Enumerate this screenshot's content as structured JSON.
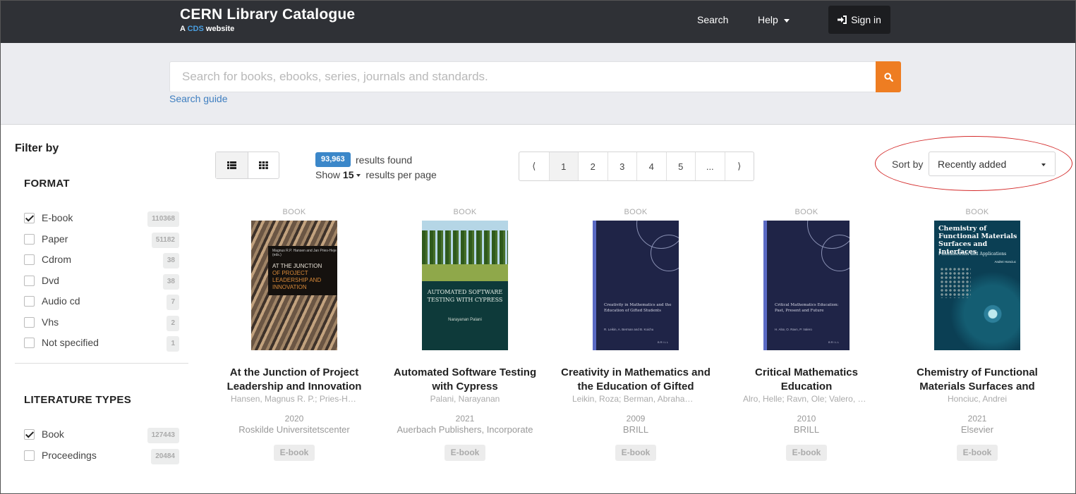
{
  "header": {
    "title": "CERN Library Catalogue",
    "subtitle_prefix": "A",
    "subtitle_link": "CDS",
    "subtitle_suffix": "website",
    "nav_search": "Search",
    "nav_help": "Help",
    "signin": "Sign in"
  },
  "search": {
    "placeholder": "Search for books, ebooks, series, journals and standards.",
    "value": "",
    "guide": "Search guide"
  },
  "sidebar": {
    "title": "Filter by",
    "format": {
      "title": "FORMAT",
      "items": [
        {
          "label": "E-book",
          "count": "110368",
          "checked": true
        },
        {
          "label": "Paper",
          "count": "51182",
          "checked": false
        },
        {
          "label": "Cdrom",
          "count": "38",
          "checked": false
        },
        {
          "label": "Dvd",
          "count": "38",
          "checked": false
        },
        {
          "label": "Audio cd",
          "count": "7",
          "checked": false
        },
        {
          "label": "Vhs",
          "count": "2",
          "checked": false
        },
        {
          "label": "Not specified",
          "count": "1",
          "checked": false
        }
      ]
    },
    "literature_types": {
      "title": "LITERATURE TYPES",
      "items": [
        {
          "label": "Book",
          "count": "127443",
          "checked": true
        },
        {
          "label": "Proceedings",
          "count": "20484",
          "checked": false
        }
      ]
    }
  },
  "results": {
    "count": "93,963",
    "found_text": "results found",
    "show_label": "Show",
    "per_page": "15",
    "per_page_suffix": "results per page"
  },
  "pagination": {
    "prev": "⟨",
    "pages": [
      "1",
      "2",
      "3",
      "4",
      "5",
      "..."
    ],
    "next": "⟩",
    "current": "1"
  },
  "sort": {
    "label": "Sort by",
    "selected": "Recently added"
  },
  "books": [
    {
      "type": "BOOK",
      "title": "At the Junction of Project Leadership and Innovation",
      "authors": "Hansen, Magnus R. P.; Pries-Heje, Jan",
      "year": "2020",
      "publisher": "Roskilde Universitetscenter",
      "format": "E-book",
      "cover": {
        "line1": "Magnus R.P. Hansen and Jan Pries-Heje (eds.)",
        "line2": "AT THE JUNCTION",
        "line3": "OF PROJECT LEADERSHIP AND INNOVATION"
      }
    },
    {
      "type": "BOOK",
      "title": "Automated Software Testing with Cypress",
      "authors": "Palani, Narayanan",
      "year": "2021",
      "publisher": "Auerbach Publishers, Incorporate",
      "format": "E-book",
      "cover": {
        "title": "AUTOMATED SOFTWARE TESTING WITH CYPRESS",
        "author": "Narayanan Palani"
      }
    },
    {
      "type": "BOOK",
      "title": "Creativity in Mathematics and the Education of Gifted Students",
      "authors": "Leikin, Roza; Berman, Abraham; Koichu, Boris",
      "year": "2009",
      "publisher": "BRILL",
      "format": "E-book",
      "cover": {
        "title": "Creativity in Mathematics and the Education of Gifted Students",
        "author": "R. Leikin, A. Berman and B. Koichu",
        "brand": "BRILL"
      }
    },
    {
      "type": "BOOK",
      "title": "Critical Mathematics Education",
      "authors": "Alro, Helle; Ravn, Ole; Valero, Paola",
      "year": "2010",
      "publisher": "BRILL",
      "format": "E-book",
      "cover": {
        "title": "Critical Mathematics Education: Past, Present and Future",
        "author": "H. Alrø, O. Ravn, P. Valero",
        "brand": "BRILL"
      }
    },
    {
      "type": "BOOK",
      "title": "Chemistry of Functional Materials Surfaces and Interfaces",
      "authors": "Honciuc, Andrei",
      "year": "2021",
      "publisher": "Elsevier",
      "format": "E-book",
      "cover": {
        "title": "Chemistry of Functional Materials Surfaces and Interfaces",
        "subtitle": "Fundamentals and Applications",
        "author": "Andrei Honciuc"
      }
    }
  ],
  "colors": {
    "header_bg": "#2f3136",
    "search_button": "#ee7d22",
    "link": "#3f7fc0",
    "results_badge": "#3b87c9",
    "highlight": "#d42a2a"
  }
}
